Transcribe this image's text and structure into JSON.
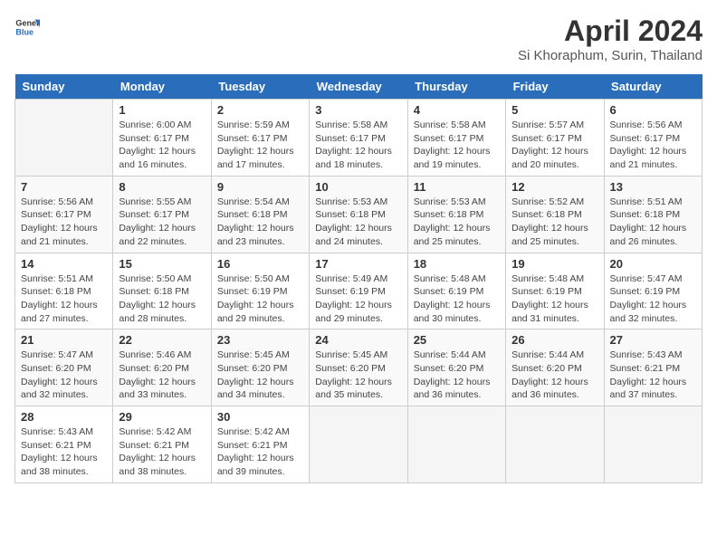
{
  "header": {
    "logo": {
      "general": "General",
      "blue": "Blue"
    },
    "title": "April 2024",
    "location": "Si Khoraphum, Surin, Thailand"
  },
  "calendar": {
    "days_of_week": [
      "Sunday",
      "Monday",
      "Tuesday",
      "Wednesday",
      "Thursday",
      "Friday",
      "Saturday"
    ],
    "weeks": [
      [
        {
          "day": "",
          "info": ""
        },
        {
          "day": "1",
          "info": "Sunrise: 6:00 AM\nSunset: 6:17 PM\nDaylight: 12 hours\nand 16 minutes."
        },
        {
          "day": "2",
          "info": "Sunrise: 5:59 AM\nSunset: 6:17 PM\nDaylight: 12 hours\nand 17 minutes."
        },
        {
          "day": "3",
          "info": "Sunrise: 5:58 AM\nSunset: 6:17 PM\nDaylight: 12 hours\nand 18 minutes."
        },
        {
          "day": "4",
          "info": "Sunrise: 5:58 AM\nSunset: 6:17 PM\nDaylight: 12 hours\nand 19 minutes."
        },
        {
          "day": "5",
          "info": "Sunrise: 5:57 AM\nSunset: 6:17 PM\nDaylight: 12 hours\nand 20 minutes."
        },
        {
          "day": "6",
          "info": "Sunrise: 5:56 AM\nSunset: 6:17 PM\nDaylight: 12 hours\nand 21 minutes."
        }
      ],
      [
        {
          "day": "7",
          "info": "Sunrise: 5:56 AM\nSunset: 6:17 PM\nDaylight: 12 hours\nand 21 minutes."
        },
        {
          "day": "8",
          "info": "Sunrise: 5:55 AM\nSunset: 6:17 PM\nDaylight: 12 hours\nand 22 minutes."
        },
        {
          "day": "9",
          "info": "Sunrise: 5:54 AM\nSunset: 6:18 PM\nDaylight: 12 hours\nand 23 minutes."
        },
        {
          "day": "10",
          "info": "Sunrise: 5:53 AM\nSunset: 6:18 PM\nDaylight: 12 hours\nand 24 minutes."
        },
        {
          "day": "11",
          "info": "Sunrise: 5:53 AM\nSunset: 6:18 PM\nDaylight: 12 hours\nand 25 minutes."
        },
        {
          "day": "12",
          "info": "Sunrise: 5:52 AM\nSunset: 6:18 PM\nDaylight: 12 hours\nand 25 minutes."
        },
        {
          "day": "13",
          "info": "Sunrise: 5:51 AM\nSunset: 6:18 PM\nDaylight: 12 hours\nand 26 minutes."
        }
      ],
      [
        {
          "day": "14",
          "info": "Sunrise: 5:51 AM\nSunset: 6:18 PM\nDaylight: 12 hours\nand 27 minutes."
        },
        {
          "day": "15",
          "info": "Sunrise: 5:50 AM\nSunset: 6:18 PM\nDaylight: 12 hours\nand 28 minutes."
        },
        {
          "day": "16",
          "info": "Sunrise: 5:50 AM\nSunset: 6:19 PM\nDaylight: 12 hours\nand 29 minutes."
        },
        {
          "day": "17",
          "info": "Sunrise: 5:49 AM\nSunset: 6:19 PM\nDaylight: 12 hours\nand 29 minutes."
        },
        {
          "day": "18",
          "info": "Sunrise: 5:48 AM\nSunset: 6:19 PM\nDaylight: 12 hours\nand 30 minutes."
        },
        {
          "day": "19",
          "info": "Sunrise: 5:48 AM\nSunset: 6:19 PM\nDaylight: 12 hours\nand 31 minutes."
        },
        {
          "day": "20",
          "info": "Sunrise: 5:47 AM\nSunset: 6:19 PM\nDaylight: 12 hours\nand 32 minutes."
        }
      ],
      [
        {
          "day": "21",
          "info": "Sunrise: 5:47 AM\nSunset: 6:20 PM\nDaylight: 12 hours\nand 32 minutes."
        },
        {
          "day": "22",
          "info": "Sunrise: 5:46 AM\nSunset: 6:20 PM\nDaylight: 12 hours\nand 33 minutes."
        },
        {
          "day": "23",
          "info": "Sunrise: 5:45 AM\nSunset: 6:20 PM\nDaylight: 12 hours\nand 34 minutes."
        },
        {
          "day": "24",
          "info": "Sunrise: 5:45 AM\nSunset: 6:20 PM\nDaylight: 12 hours\nand 35 minutes."
        },
        {
          "day": "25",
          "info": "Sunrise: 5:44 AM\nSunset: 6:20 PM\nDaylight: 12 hours\nand 36 minutes."
        },
        {
          "day": "26",
          "info": "Sunrise: 5:44 AM\nSunset: 6:20 PM\nDaylight: 12 hours\nand 36 minutes."
        },
        {
          "day": "27",
          "info": "Sunrise: 5:43 AM\nSunset: 6:21 PM\nDaylight: 12 hours\nand 37 minutes."
        }
      ],
      [
        {
          "day": "28",
          "info": "Sunrise: 5:43 AM\nSunset: 6:21 PM\nDaylight: 12 hours\nand 38 minutes."
        },
        {
          "day": "29",
          "info": "Sunrise: 5:42 AM\nSunset: 6:21 PM\nDaylight: 12 hours\nand 38 minutes."
        },
        {
          "day": "30",
          "info": "Sunrise: 5:42 AM\nSunset: 6:21 PM\nDaylight: 12 hours\nand 39 minutes."
        },
        {
          "day": "",
          "info": ""
        },
        {
          "day": "",
          "info": ""
        },
        {
          "day": "",
          "info": ""
        },
        {
          "day": "",
          "info": ""
        }
      ]
    ]
  }
}
